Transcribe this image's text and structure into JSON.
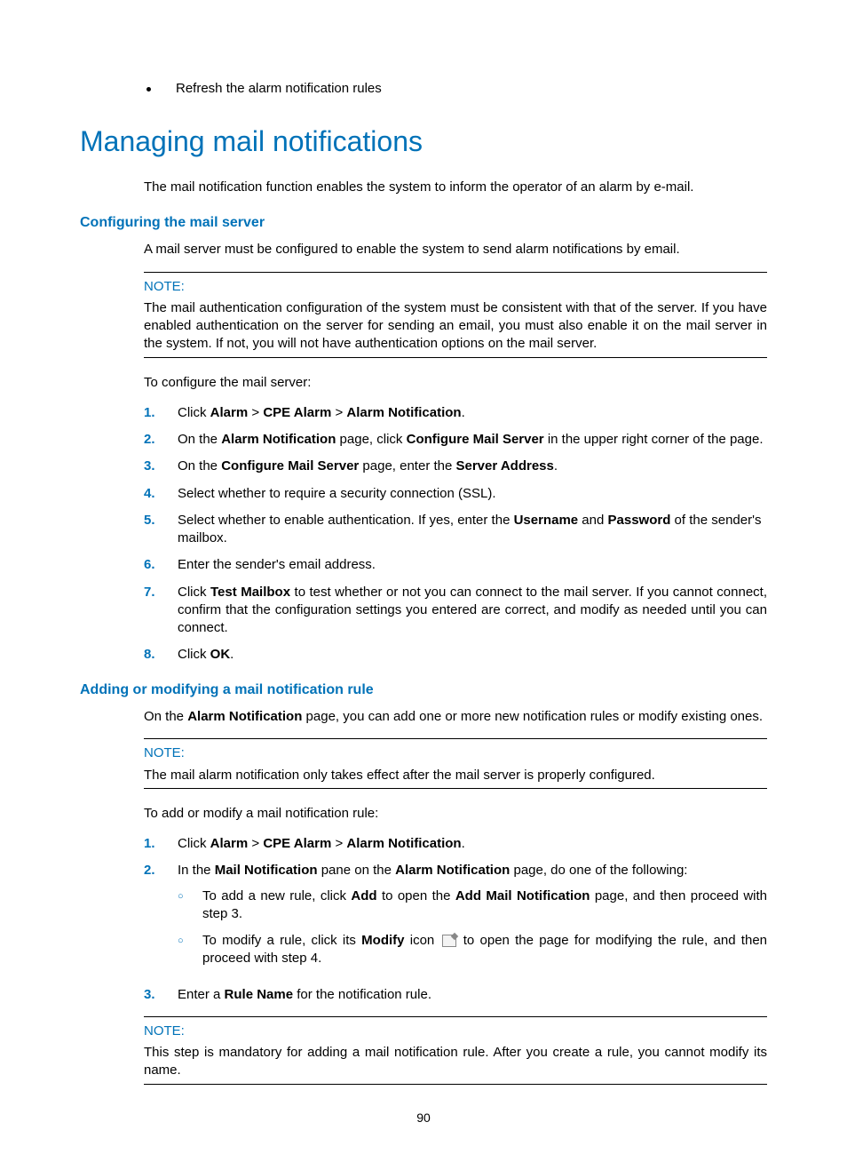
{
  "top_bullet": "Refresh the alarm notification rules",
  "h1": "Managing mail notifications",
  "intro": "The mail notification function enables the system to inform the operator of an alarm by e-mail.",
  "sect1": {
    "title": "Configuring the mail server",
    "lead": "A mail server must be configured to enable the system to send alarm notifications by email.",
    "note_label": "NOTE:",
    "note_body": "The mail authentication configuration of the system must be consistent with that of the server. If you have enabled authentication on the server for sending an email, you must also enable it on the mail server in the system. If not, you will not have authentication options on the mail server.",
    "pre_list": "To configure the mail server:",
    "steps": {
      "s1a": "Click ",
      "s1b": "Alarm",
      "s1c": " > ",
      "s1d": "CPE Alarm",
      "s1e": " > ",
      "s1f": "Alarm Notification",
      "s1g": ".",
      "s2a": "On the ",
      "s2b": "Alarm Notification",
      "s2c": " page, click ",
      "s2d": "Configure Mail Server",
      "s2e": " in the upper right corner of the page.",
      "s3a": "On the ",
      "s3b": "Configure Mail Server",
      "s3c": " page, enter the ",
      "s3d": "Server Address",
      "s3e": ".",
      "s4": "Select whether to require a security connection (SSL).",
      "s5a": "Select whether to enable authentication. If yes, enter the ",
      "s5b": "Username",
      "s5c": " and ",
      "s5d": "Password",
      "s5e": " of the sender's mailbox.",
      "s6": "Enter the sender's email address.",
      "s7a": "Click ",
      "s7b": "Test Mailbox",
      "s7c": " to test whether or not you can connect to the mail server. If you cannot connect, confirm that the configuration settings you entered are correct, and modify as needed until you can connect.",
      "s8a": "Click ",
      "s8b": "OK",
      "s8c": "."
    }
  },
  "sect2": {
    "title": "Adding or modifying a mail notification rule",
    "lead_a": "On the ",
    "lead_b": "Alarm Notification",
    "lead_c": " page, you can add one or more new notification rules or modify existing ones.",
    "note_label": "NOTE:",
    "note_body": "The mail alarm notification only takes effect after the mail server is properly configured.",
    "pre_list": "To add or modify a mail notification rule:",
    "steps": {
      "s1a": "Click ",
      "s1b": "Alarm",
      "s1c": " > ",
      "s1d": "CPE Alarm",
      "s1e": " > ",
      "s1f": "Alarm Notification",
      "s1g": ".",
      "s2a": "In the ",
      "s2b": "Mail Notification",
      "s2c": " pane on the ",
      "s2d": "Alarm Notification",
      "s2e": " page, do one of the following:",
      "sub1a": "To add a new rule, click ",
      "sub1b": "Add",
      "sub1c": " to open the ",
      "sub1d": "Add Mail Notification",
      "sub1e": " page, and then proceed with step 3.",
      "sub2a": "To modify a rule, click its ",
      "sub2b": "Modify",
      "sub2c": " icon ",
      "sub2d": " to open the page for modifying the rule, and then proceed with step 4.",
      "s3a": "Enter a ",
      "s3b": "Rule Name",
      "s3c": " for the notification rule."
    },
    "note2_label": "NOTE:",
    "note2_body": "This step is mandatory for adding a mail notification rule. After you create a rule, you cannot modify its name."
  },
  "page_number": "90"
}
